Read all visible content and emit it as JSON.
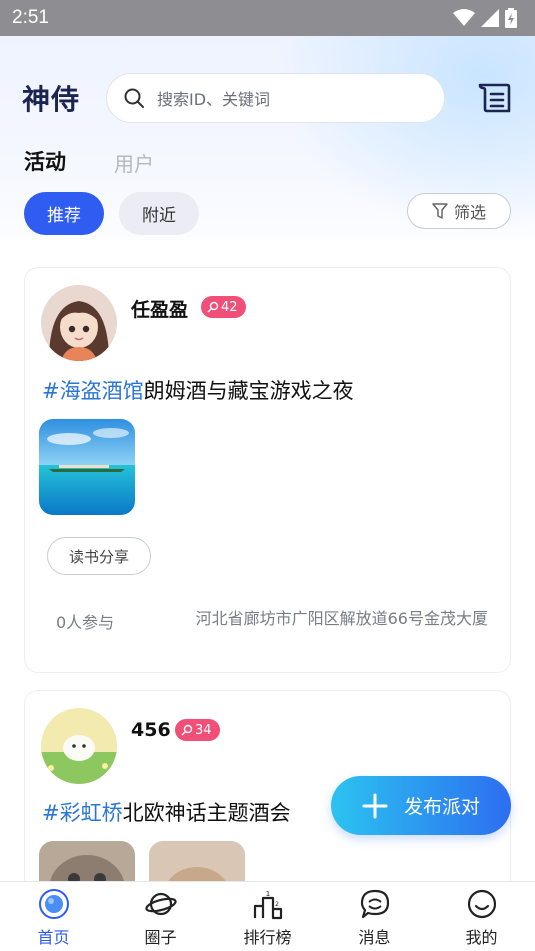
{
  "status_bar": {
    "time": "2:51"
  },
  "header": {
    "logo_text": "神侍",
    "search_placeholder": "搜索ID、关键词"
  },
  "tabs": [
    {
      "label": "活动",
      "active": true
    },
    {
      "label": "用户",
      "active": false
    }
  ],
  "chips": [
    {
      "label": "推荐",
      "active": true
    },
    {
      "label": "附近",
      "active": false
    }
  ],
  "filter_label": "筛选",
  "posts": [
    {
      "user_name": "任盈盈",
      "badge_value": "42",
      "hashtag": "#海盗酒馆",
      "title": "朗姆酒与藏宝游戏之夜",
      "tag": "读书分享",
      "participants": "0人参与",
      "address": "河北省廊坊市广阳区解放道66号金茂大厦"
    },
    {
      "user_name": "456",
      "badge_value": "34",
      "hashtag": "#彩虹桥",
      "title": "北欧神话主题酒会"
    }
  ],
  "fab_label": "发布派对",
  "bottom_nav": [
    {
      "label": "首页",
      "icon": "home-icon",
      "active": true
    },
    {
      "label": "圈子",
      "icon": "planet-icon",
      "active": false
    },
    {
      "label": "排行榜",
      "icon": "podium-icon",
      "active": false
    },
    {
      "label": "消息",
      "icon": "chat-icon",
      "active": false
    },
    {
      "label": "我的",
      "icon": "profile-icon",
      "active": false
    }
  ],
  "colors": {
    "accent": "#2f5cf1",
    "badge": "#f05077",
    "hashtag": "#2a76d6"
  }
}
